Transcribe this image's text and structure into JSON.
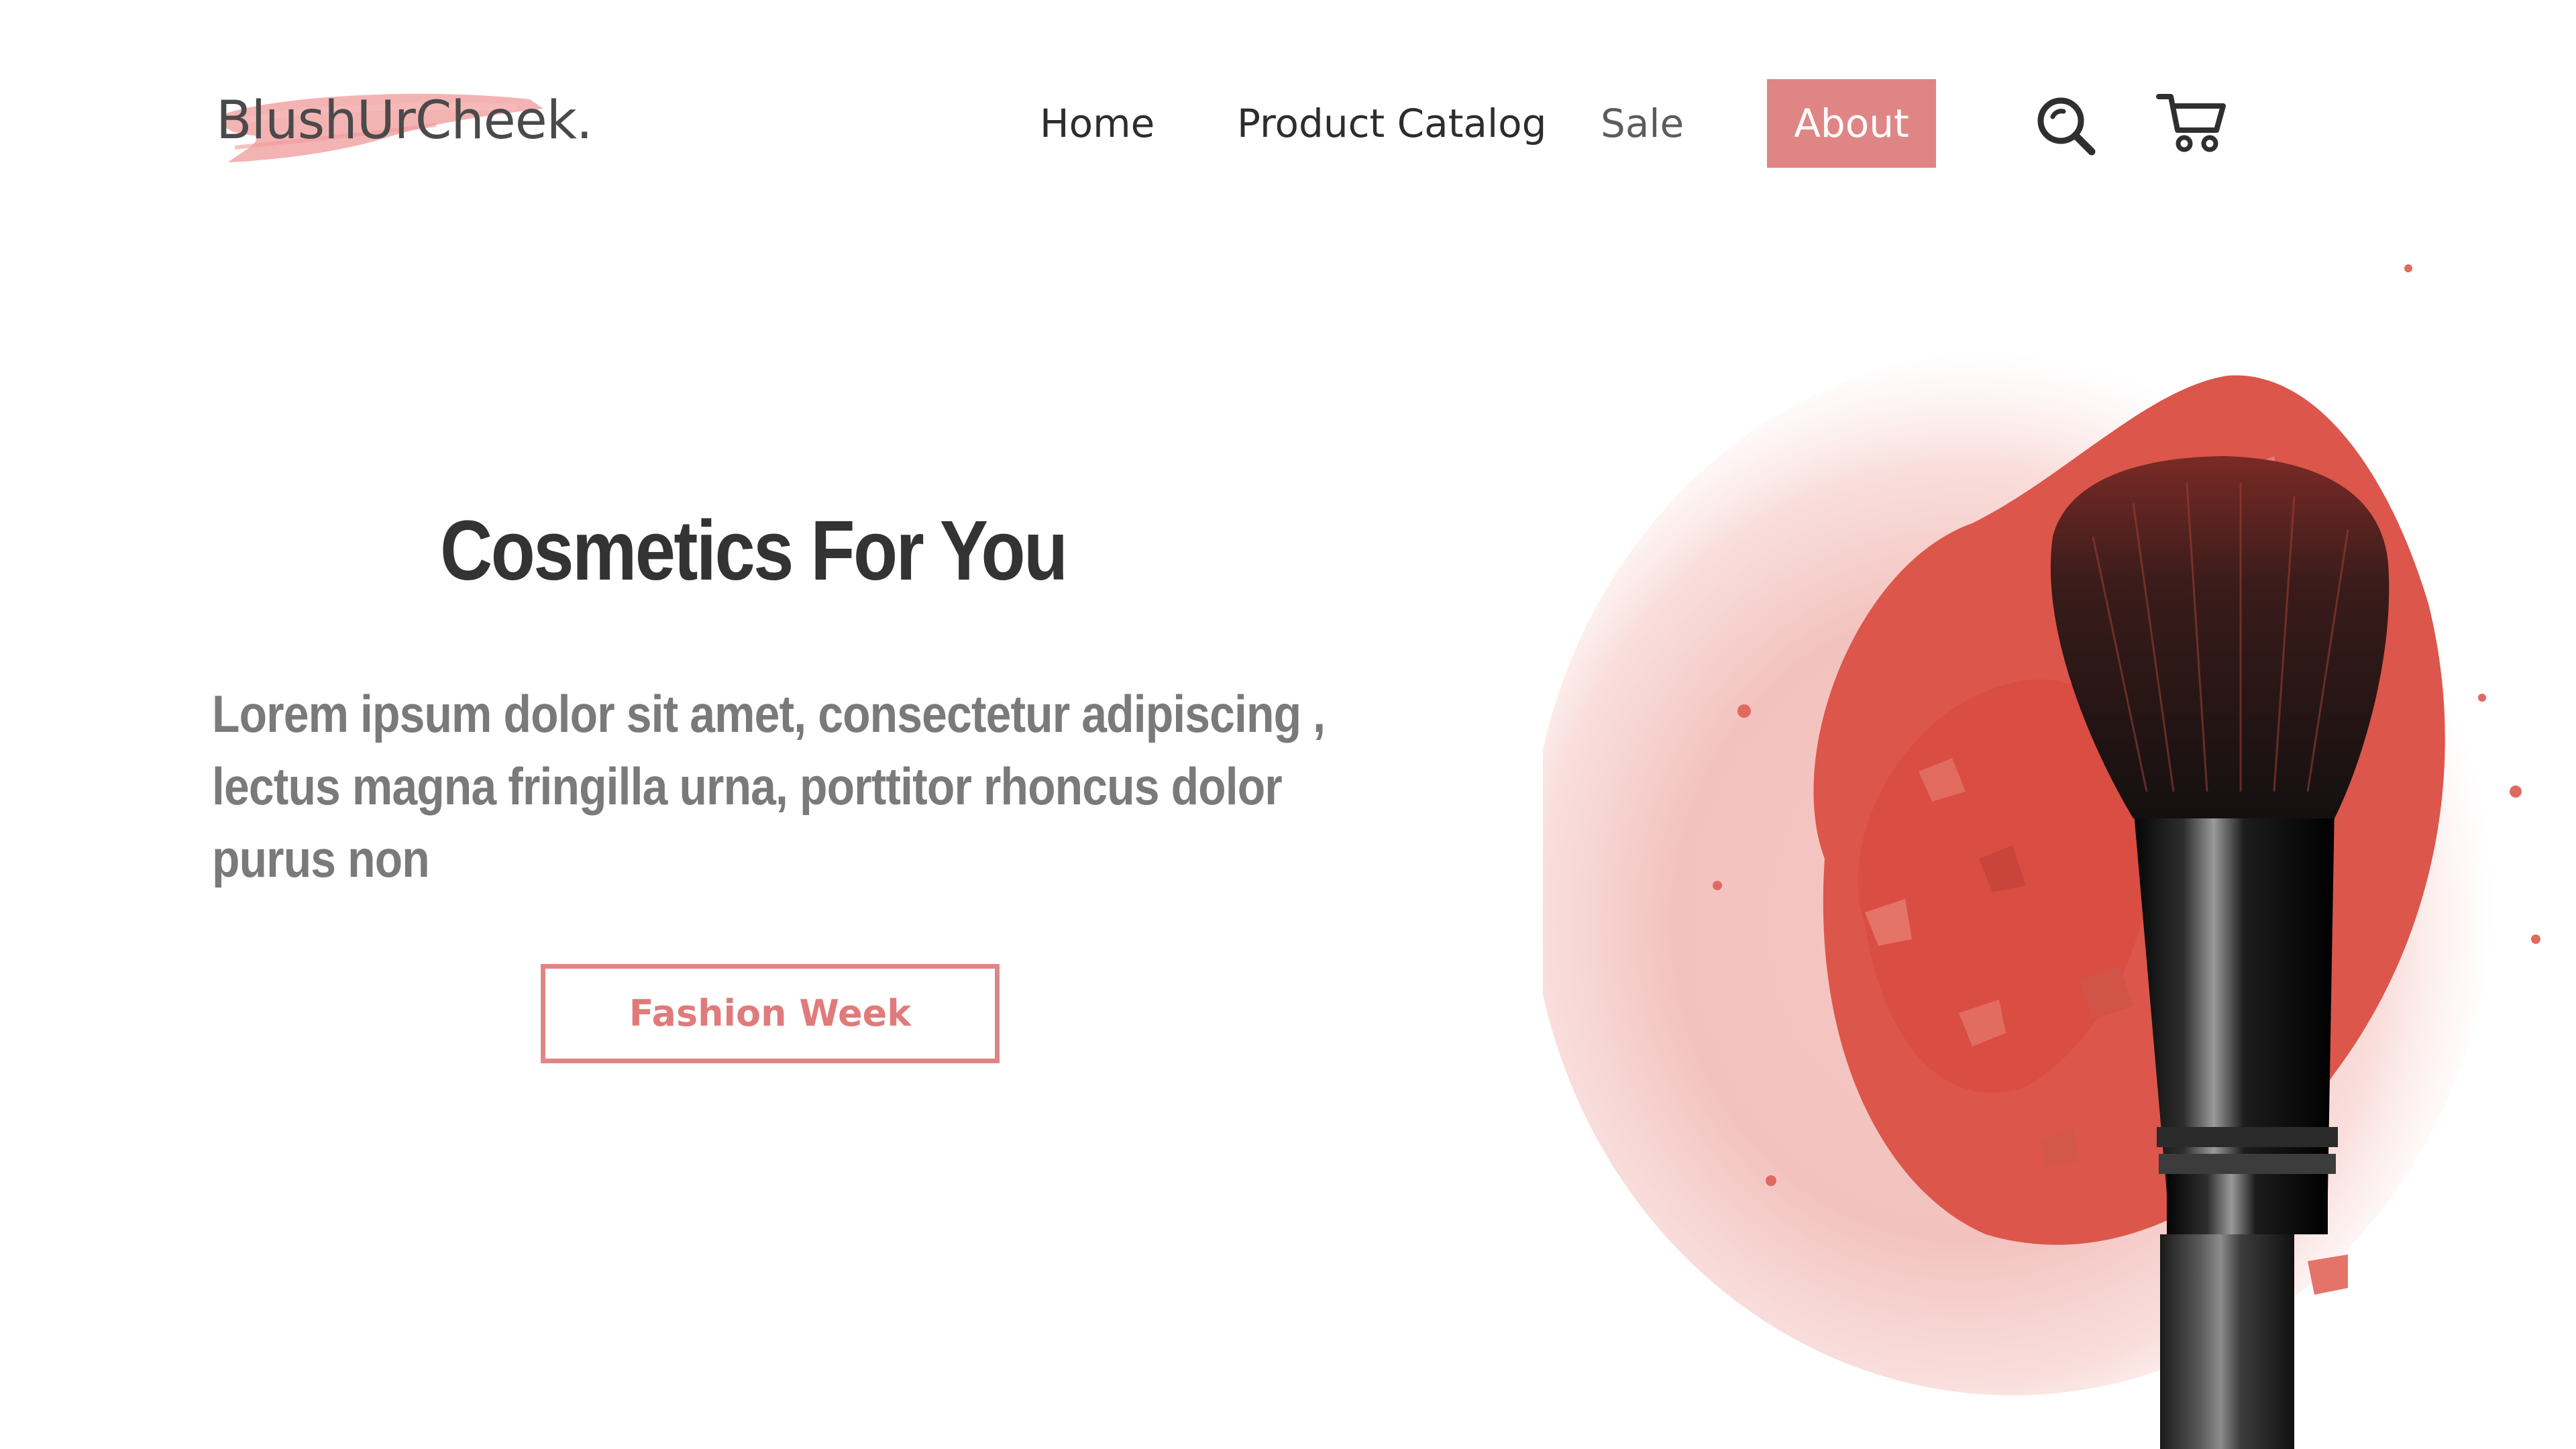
{
  "brand": {
    "name": "BlushUrCheek.",
    "accent_color": "#e08585"
  },
  "nav": {
    "items": [
      {
        "label": "Home"
      },
      {
        "label": "Product Catalog"
      },
      {
        "label": "Sale"
      },
      {
        "label": "About",
        "active": true
      }
    ],
    "icons": [
      "search-icon",
      "shopping-cart-icon"
    ]
  },
  "hero": {
    "title": "Cosmetics For You",
    "body": "Lorem ipsum dolor sit amet, consectetur adipiscing , lectus magna fringilla urna, porttitor rhoncus dolor purus non",
    "cta_label": "Fashion Week",
    "image": "makeup-brush-with-crushed-blush-powder"
  }
}
